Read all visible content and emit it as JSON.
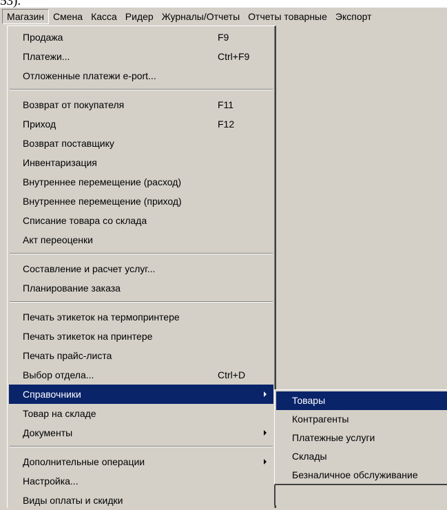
{
  "top_text": "53).",
  "menubar": {
    "items": [
      "Магазин",
      "Смена",
      "Касса",
      "Ридер",
      "Журналы/Отчеты",
      "Отчеты товарные",
      "Экспорт"
    ]
  },
  "main_menu": {
    "groups": [
      [
        {
          "label": "Продажа",
          "shortcut": "F9"
        },
        {
          "label": "Платежи...",
          "shortcut": "Ctrl+F9"
        },
        {
          "label": "Отложенные платежи e-port...",
          "shortcut": ""
        }
      ],
      [
        {
          "label": "Возврат от покупателя",
          "shortcut": "F11"
        },
        {
          "label": "Приход",
          "shortcut": "F12"
        },
        {
          "label": "Возврат поставщику",
          "shortcut": ""
        },
        {
          "label": "Инвентаризация",
          "shortcut": ""
        },
        {
          "label": "Внутреннее перемещение (расход)",
          "shortcut": ""
        },
        {
          "label": "Внутреннее перемещение (приход)",
          "shortcut": ""
        },
        {
          "label": "Списание товара со склада",
          "shortcut": ""
        },
        {
          "label": "Акт переоценки",
          "shortcut": ""
        }
      ],
      [
        {
          "label": "Составление и расчет услуг...",
          "shortcut": ""
        },
        {
          "label": "Планирование заказа",
          "shortcut": ""
        }
      ],
      [
        {
          "label": "Печать этикеток на термопринтере",
          "shortcut": ""
        },
        {
          "label": "Печать этикеток на принтере",
          "shortcut": ""
        },
        {
          "label": "Печать прайс-листа",
          "shortcut": ""
        },
        {
          "label": "Выбор отдела...",
          "shortcut": "Ctrl+D"
        },
        {
          "label": "Справочники",
          "shortcut": "",
          "submenu": true,
          "highlighted": true
        },
        {
          "label": "Товар на складе",
          "shortcut": ""
        },
        {
          "label": "Документы",
          "shortcut": "",
          "submenu": true
        }
      ],
      [
        {
          "label": "Дополнительные операции",
          "shortcut": "",
          "submenu": true
        },
        {
          "label": "Настройка...",
          "shortcut": ""
        },
        {
          "label": "Виды оплаты и скидки",
          "shortcut": ""
        }
      ]
    ]
  },
  "sub_menu": {
    "items": [
      {
        "label": "Товары",
        "highlighted": true
      },
      {
        "label": "Контрагенты"
      },
      {
        "label": "Платежные услуги"
      },
      {
        "label": "Склады"
      },
      {
        "label": "Безналичное обслуживание"
      }
    ]
  },
  "colors": {
    "face": "#d4d0c8",
    "highlight": "#0a246a",
    "highlight_text": "#ffffff"
  }
}
